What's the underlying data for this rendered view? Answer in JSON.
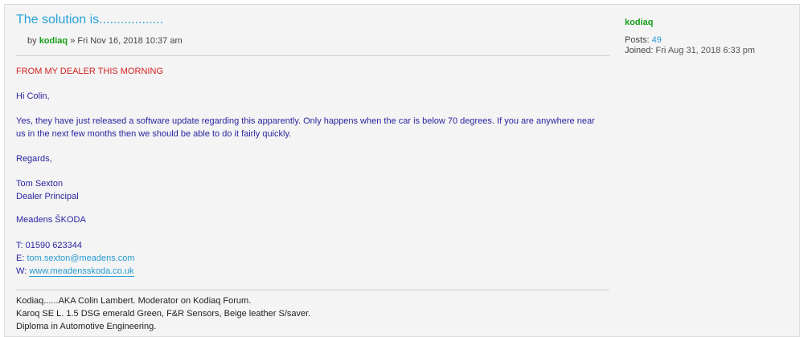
{
  "post": {
    "title": "The solution is..................",
    "byline_prefix": "by",
    "author": "kodiaq",
    "byline_sep": "»",
    "date": "Fri Nov 16, 2018 10:37 am",
    "content": {
      "l1": "FROM MY DEALER THIS MORNING",
      "l2": "Hi Colin,",
      "l3": "Yes, they have just released a software update regarding this apparently. Only happens when the car is below 70 degrees. If you are anywhere near",
      "l4": "us in the next few months then we should be able to do it fairly quickly.",
      "l5": "Regards,",
      "l6": "Tom Sexton",
      "l7": "Dealer Principal",
      "l8": "Meadens ŠKODA",
      "phone_line": "T: 01590 623344",
      "email_label": "E:",
      "email": "tom.sexton@meadens.com",
      "web_label": "W:",
      "web": "www.meadensskoda.co.uk"
    },
    "signature": {
      "l1": "Kodiaq......AKA Colin Lambert. Moderator on Kodiaq Forum.",
      "l2": "Karoq SE L. 1.5 DSG emerald Green, F&R Sensors, Beige leather S/saver.",
      "l3": "Diploma in Automotive Engineering."
    }
  },
  "profile": {
    "username": "kodiaq",
    "posts_label": "Posts:",
    "posts_value": "49",
    "joined_label": "Joined:",
    "joined_value": "Fri Aug 31, 2018 6:33 pm"
  }
}
